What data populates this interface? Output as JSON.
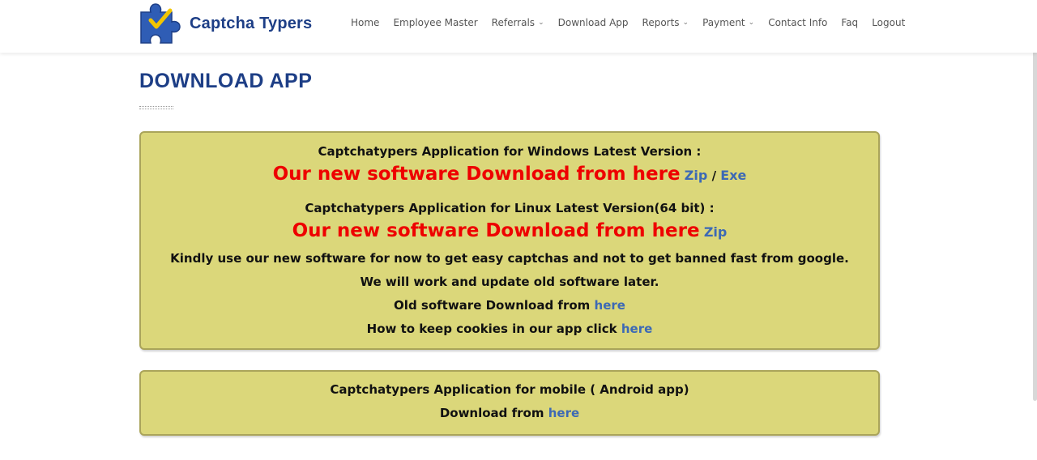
{
  "brand": {
    "name": "Captcha Typers",
    "logo_icon": "puzzle-checkmark-icon"
  },
  "nav": {
    "items": [
      {
        "label": "Home",
        "dropdown": false
      },
      {
        "label": "Employee Master",
        "dropdown": false
      },
      {
        "label": "Referrals",
        "dropdown": true
      },
      {
        "label": "Download App",
        "dropdown": false
      },
      {
        "label": "Reports",
        "dropdown": true
      },
      {
        "label": "Payment",
        "dropdown": true
      },
      {
        "label": "Contact Info",
        "dropdown": false
      },
      {
        "label": "Faq",
        "dropdown": false
      },
      {
        "label": "Logout",
        "dropdown": false
      }
    ],
    "dropdown_icon": "chevron-down-icon"
  },
  "page": {
    "title": "DOWNLOAD APP"
  },
  "windows_panel": {
    "heading": "Captchatypers Application for Windows Latest Version :",
    "promo": "Our new software Download from here",
    "zip_link": "Zip",
    "separator": "/",
    "exe_link": "Exe"
  },
  "linux_panel": {
    "heading": "Captchatypers Application for Linux Latest Version(64 bit) :",
    "promo": "Our new software Download from here",
    "zip_link": "Zip"
  },
  "notes": {
    "line1": "Kindly use our new software for now to get easy captchas and not to get banned fast from google.",
    "line2": "We will work and update old software later.",
    "old_software_text": "Old software Download from",
    "old_software_link": "here",
    "cookies_text": "How to keep cookies in our app click",
    "cookies_link": "here"
  },
  "mobile_panel": {
    "heading": "Captchatypers Application for mobile ( Android app)",
    "download_text": "Download from",
    "download_link": "here"
  },
  "colors": {
    "brand_blue": "#1d3e86",
    "panel_bg": "#dbd77a",
    "promo_red": "#ee0000",
    "link_blue": "#3c69b5"
  }
}
